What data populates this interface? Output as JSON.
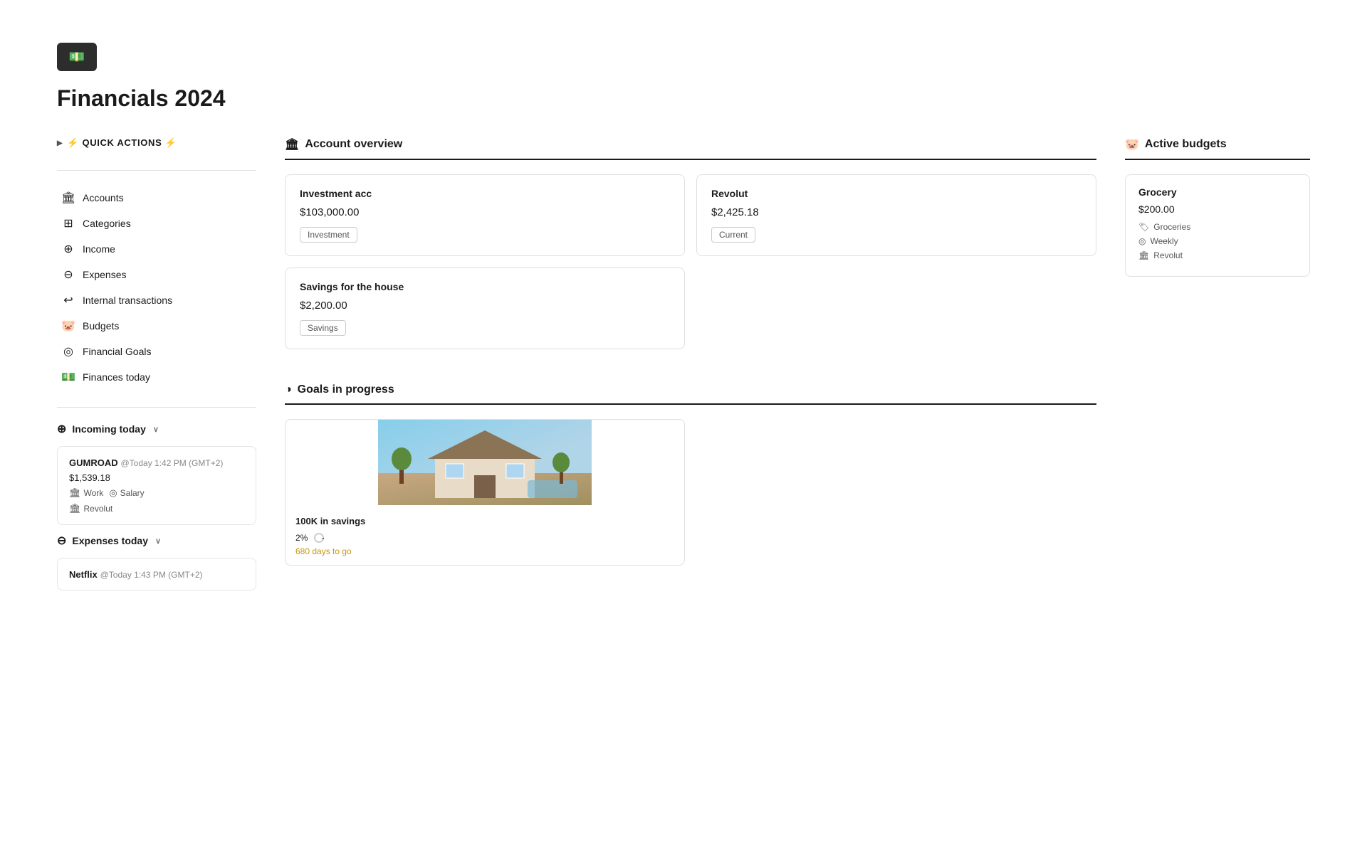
{
  "header": {
    "logo_icon": "💵",
    "title": "Financials 2024"
  },
  "sidebar": {
    "quick_actions_label": "⚡ QUICK ACTIONS ⚡",
    "nav_items": [
      {
        "id": "accounts",
        "icon": "🏛",
        "label": "Accounts"
      },
      {
        "id": "categories",
        "icon": "⊞",
        "label": "Categories"
      },
      {
        "id": "income",
        "icon": "⊕",
        "label": "Income"
      },
      {
        "id": "expenses",
        "icon": "⊖",
        "label": "Expenses"
      },
      {
        "id": "internal-transactions",
        "icon": "↩",
        "label": "Internal transactions"
      },
      {
        "id": "budgets",
        "icon": "🐷",
        "label": "Budgets"
      },
      {
        "id": "financial-goals",
        "icon": "◎",
        "label": "Financial Goals"
      },
      {
        "id": "finances-today",
        "icon": "💵",
        "label": "Finances today"
      }
    ],
    "incoming_today": {
      "label": "Incoming today",
      "icon": "⊕",
      "transactions": [
        {
          "title": "GUMROAD",
          "time": "@Today 1:42 PM (GMT+2)",
          "amount": "$1,539.18",
          "tags": [
            {
              "icon": "🏛",
              "label": "Work"
            },
            {
              "icon": "◎",
              "label": "Salary"
            }
          ],
          "account": "Revolut",
          "account_icon": "🏛"
        }
      ]
    },
    "expenses_today": {
      "label": "Expenses today",
      "icon": "⊖",
      "transactions": [
        {
          "title": "Netflix",
          "time": "@Today 1:43 PM (GMT+2)",
          "amount": ""
        }
      ]
    }
  },
  "main": {
    "account_overview": {
      "label": "Account overview",
      "icon": "🏛",
      "accounts": [
        {
          "title": "Investment acc",
          "amount": "$103,000.00",
          "badge": "Investment"
        },
        {
          "title": "Revolut",
          "amount": "$2,425.18",
          "badge": "Current"
        },
        {
          "title": "Savings for the house",
          "amount": "$2,200.00",
          "badge": "Savings"
        }
      ]
    },
    "goals": {
      "label": "Goals in progress",
      "icon": "◑",
      "items": [
        {
          "title": "100K in savings",
          "progress_percent": "2%",
          "days_label": "680 days to go"
        }
      ]
    }
  },
  "right_panel": {
    "active_budgets": {
      "label": "Active budgets",
      "icon": "🐷",
      "budgets": [
        {
          "title": "Grocery",
          "amount": "$200.00",
          "category_icon": "🏷",
          "category": "Groceries",
          "frequency_icon": "◎",
          "frequency": "Weekly",
          "account_icon": "🏛",
          "account": "Revolut"
        }
      ]
    }
  }
}
